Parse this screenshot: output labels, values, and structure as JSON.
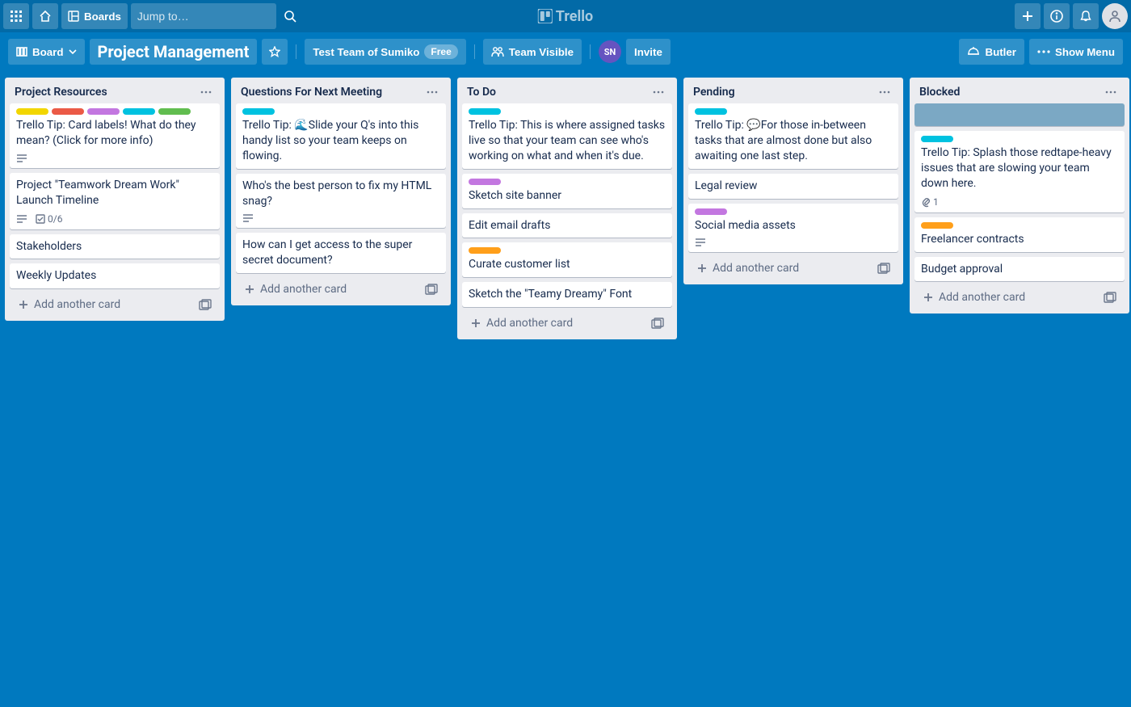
{
  "colors": {
    "yellow": "#f2d600",
    "red": "#eb5a46",
    "purple": "#c377e0",
    "sky": "#00c2e0",
    "lime": "#61bd4f",
    "orange": "#ff9f1a"
  },
  "header": {
    "boards_label": "Boards",
    "search_placeholder": "Jump to…",
    "logo_text": "Trello"
  },
  "board_bar": {
    "view_label": "Board",
    "board_name": "Project Management",
    "team_label": "Test Team of Sumiko",
    "team_plan": "Free",
    "visibility_label": "Team Visible",
    "invite_label": "Invite",
    "butler_label": "Butler",
    "menu_label": "Show Menu",
    "member_initials": "SN"
  },
  "add_card_label": "Add another card",
  "lists": [
    {
      "title": "Project Resources",
      "cards": [
        {
          "labels": [
            "yellow",
            "red",
            "purple",
            "sky",
            "lime"
          ],
          "text": "Trello Tip: Card labels! What do they mean? (Click for more info)",
          "badges": {
            "desc": true
          }
        },
        {
          "text": "Project \"Teamwork Dream Work\" Launch Timeline",
          "badges": {
            "desc": true,
            "checklist": "0/6"
          }
        },
        {
          "text": "Stakeholders"
        },
        {
          "text": "Weekly Updates"
        }
      ]
    },
    {
      "title": "Questions For Next Meeting",
      "cards": [
        {
          "labels": [
            "sky"
          ],
          "text": "Trello Tip: 🌊Slide your Q's into this handy list so your team keeps on flowing."
        },
        {
          "text": "Who's the best person to fix my HTML snag?",
          "badges": {
            "desc": true
          }
        },
        {
          "text": "How can I get access to the super secret document?"
        }
      ]
    },
    {
      "title": "To Do",
      "cards": [
        {
          "labels": [
            "sky"
          ],
          "text": "Trello Tip: This is where assigned tasks live so that your team can see who's working on what and when it's due."
        },
        {
          "labels": [
            "purple"
          ],
          "text": "Sketch site banner"
        },
        {
          "text": "Edit email drafts"
        },
        {
          "labels": [
            "orange"
          ],
          "text": "Curate customer list"
        },
        {
          "text": "Sketch the \"Teamy Dreamy\" Font"
        }
      ]
    },
    {
      "title": "Pending",
      "cards": [
        {
          "labels": [
            "sky"
          ],
          "text": "Trello Tip: 💬For those in-between tasks that are almost done but also awaiting one last step."
        },
        {
          "text": "Legal review"
        },
        {
          "labels": [
            "purple"
          ],
          "text": "Social media assets",
          "badges": {
            "desc": true
          }
        }
      ]
    },
    {
      "title": "Blocked",
      "cards": [
        {
          "placeholder": true
        },
        {
          "labels": [
            "sky"
          ],
          "text": "Trello Tip: Splash those redtape-heavy issues that are slowing your team down here.",
          "badges": {
            "attach": "1"
          }
        },
        {
          "labels": [
            "orange"
          ],
          "text": "Freelancer contracts"
        },
        {
          "text": "Budget approval"
        }
      ]
    }
  ]
}
